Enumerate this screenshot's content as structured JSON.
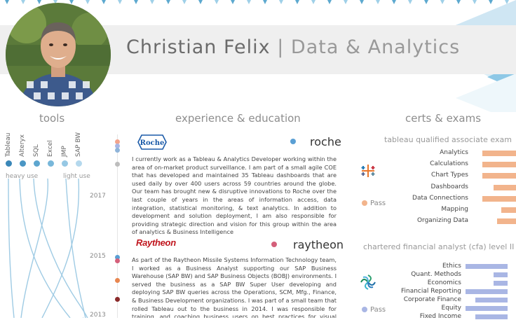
{
  "header": {
    "name": "Christian Felix",
    "separator": "|",
    "role": "Data & Analytics"
  },
  "colors": {
    "accent_blue": "#5da9cf",
    "light_blue": "#a5d4ea",
    "orange_bar": "#f2b48c",
    "blue_bar": "#a9b6e4",
    "banner_gray": "#efefef"
  },
  "tools": {
    "title": "tools",
    "items": [
      {
        "label": "Tableau",
        "color": "#3a87b8"
      },
      {
        "label": "Alteryx",
        "color": "#4a96c4"
      },
      {
        "label": "SQL",
        "color": "#5da6cf"
      },
      {
        "label": "Excel",
        "color": "#78b7da"
      },
      {
        "label": "JMP",
        "color": "#96c8e4"
      },
      {
        "label": "SAP BW",
        "color": "#b4d8ed"
      }
    ],
    "heavy_label": "heavy use",
    "light_label": "light use",
    "years": [
      "2017",
      "2015",
      "2013"
    ]
  },
  "experience": {
    "title": "experience & education",
    "entries": [
      {
        "logo": "Roche",
        "company": "roche",
        "dot_color": "#5a9fd4",
        "text": "I currently work as a Tableau & Analytics Developer working within the area of on-market product surveillance. I am part of a small agile COE that has developed and maintained 35 Tableau dashboards that are used daily by over 400 users across 59 countries around the globe. Our team has brought new & disruptive innovations to Roche over the last couple of years in the areas of information access, data integration, statistical monitoring, & text analytics. In addition to development and solution deployment, I am also responsible for providing strategic direction and vision for this group within the area of analytics & Business Intelligence"
      },
      {
        "logo": "Raytheon",
        "company": "raytheon",
        "dot_color": "#d45f7a",
        "text": "As part of the Raytheon Missile Systems Information Technology team, I worked as a Business Analyst supporting our SAP Business Warehouse (SAP BW) and SAP Business Objects (BOBJ) environments. I served the business as a SAP BW Super User developing and deploying SAP BW queries across the Operations, SCM, Mfg., Finance, & Business Development organizations. I was part of a small team that rolled Tableau out to the business in 2014. I was responsible for training, and coaching business users on best practices for visual analytics in Tableau"
      }
    ],
    "timeline_dots": [
      "#f2a48c",
      "#a9b6e4",
      "#8fb4d9",
      "#bdbdbd",
      "#5a9fd4",
      "#d45f7a",
      "#e8864f",
      "#8b2b2b"
    ]
  },
  "certs": {
    "title": "certs & exams",
    "tableau": {
      "title": "tableau qualified associate exam",
      "status": "Pass",
      "status_color": "#f2b48c",
      "icon": "tableau-logo-icon",
      "categories": [
        "Analytics",
        "Calculations",
        "Chart Types",
        "Dashboards",
        "Data Connections",
        "Mapping",
        "Organizing Data"
      ],
      "values": [
        0.82,
        0.82,
        0.82,
        0.62,
        0.82,
        0.49,
        0.56
      ]
    },
    "cfa": {
      "title": "chartered financial analyst (cfa) level II",
      "status": "Pass",
      "status_color": "#a9b6e4",
      "icon": "cfa-logo-icon",
      "categories": [
        "Ethics",
        "Quant. Methods",
        "Economics",
        "Financial Reporting",
        "Corporate Finance",
        "Equity",
        "Fixed Income"
      ],
      "values": [
        1.0,
        0.34,
        0.34,
        1.0,
        0.77,
        1.0,
        0.77
      ]
    }
  }
}
